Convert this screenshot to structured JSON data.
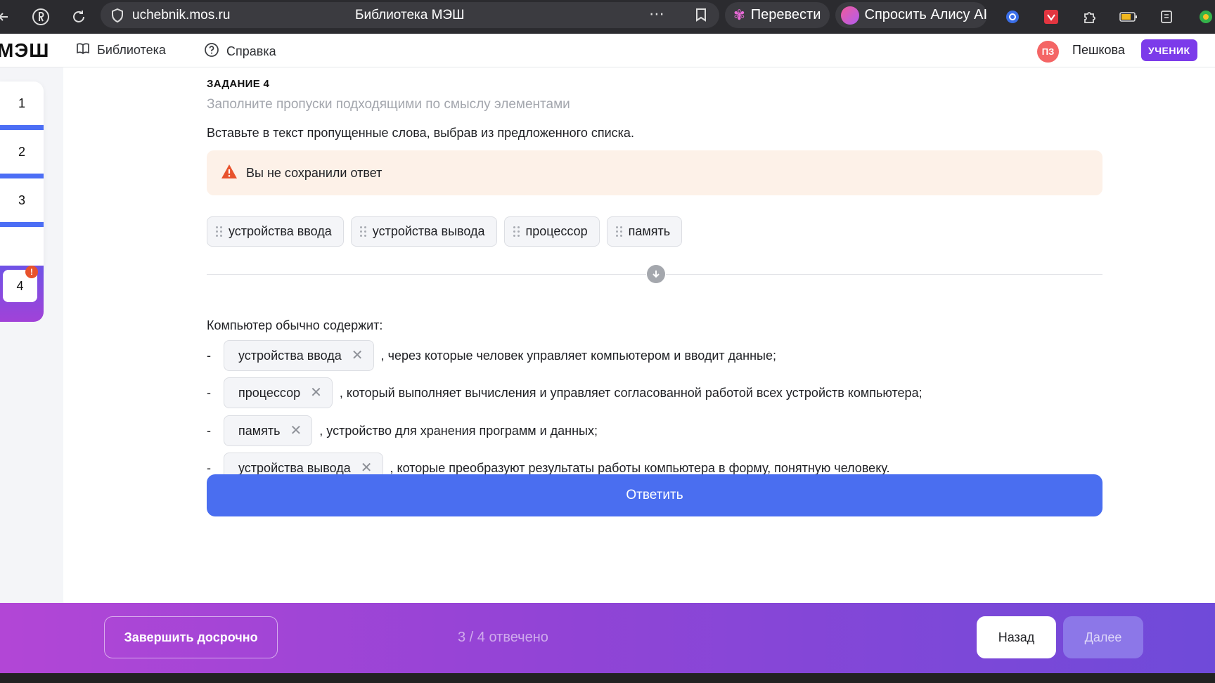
{
  "browser": {
    "host": "uchebnik.mos.ru",
    "page_title": "Библиотека МЭШ",
    "translate_label": "Перевести",
    "alice_label": "Спросить Алису AI"
  },
  "nav": {
    "logo": "МЭШ",
    "library": "Библиотека",
    "help": "Справка",
    "avatar_initials": "ПЗ",
    "user_name": "Пешкова",
    "role": "УЧЕНИК"
  },
  "questions": [
    "1",
    "2",
    "3",
    "4"
  ],
  "current_question": "4",
  "current_badge": "!",
  "task": {
    "title": "ЗАДАНИЕ 4",
    "subtitle": "Заполните пропуски подходящими по смыслу элементами",
    "instruction": "Вставьте в текст пропущенные слова, выбрав из предложенного списка.",
    "warning": "Вы не сохранили ответ",
    "options": [
      "устройства ввода",
      "устройства вывода",
      "процессор",
      "память"
    ],
    "intro": "Компьютер обычно содержит:",
    "rows": [
      {
        "dash": "-",
        "filled": "устройства ввода",
        "text": ", через которые человек управляет компьютером и вводит данные;"
      },
      {
        "dash": "-",
        "filled": "процессор",
        "text": ", который выполняет вычисления и управляет согласованной работой всех устройств компьютера;"
      },
      {
        "dash": "-",
        "filled": "память",
        "text": ", устройство для хранения программ и данных;"
      },
      {
        "dash": "-",
        "filled": "устройства вывода",
        "text": ", которые преобразуют результаты работы компьютера в форму, понятную человеку."
      }
    ],
    "submit": "Ответить"
  },
  "footer": {
    "finish": "Завершить досрочно",
    "progress": "3 / 4 отвечено",
    "back": "Назад",
    "next": "Далее"
  },
  "colors": {
    "primary": "#4a6ef0",
    "role_badge": "#7c3bea",
    "warning_bg": "#fdf1e8",
    "warning_icon": "#e8522c"
  }
}
